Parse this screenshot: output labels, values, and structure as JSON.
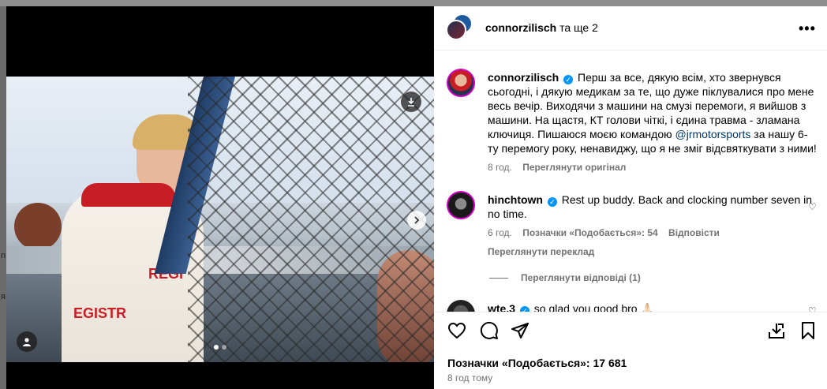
{
  "background": {
    "side_chars": [
      "n",
      "я"
    ]
  },
  "header": {
    "username": "connorzilisch",
    "others": "та ще 2",
    "more": "•••"
  },
  "post": {
    "caption_user": "connorzilisch",
    "caption_text": "Перш за все, дякую всім, хто звернувся сьогодні, і дякую медикам за те, що дуже піклувалися про мене весь вечір. Виходячи з машини на смузі перемоги, я вийшов з машини. На щастя, КТ голови чіткі, і єдина травма - зламана ключиця. Пишаюся моєю командою ",
    "caption_mention": "@jrmotorsports",
    "caption_tail": " за нашу 6-ту перемогу року, ненавиджу, що я не зміг відсвяткувати з ними!",
    "caption_time": "8 год.",
    "caption_translate": "Переглянути оригінал"
  },
  "comments": [
    {
      "user": "hinchtown",
      "text": "Rest up buddy. Back and clocking number seven in no time.",
      "time": "6 год.",
      "likes": "Позначки «Подобається»: 54",
      "reply": "Відповісти",
      "translate": "Переглянути переклад",
      "view_replies": "Переглянути відповіді (1)"
    },
    {
      "user": "wte.3",
      "text": "so glad you good bro 🙏🏻"
    }
  ],
  "photo_text": {
    "suit_regis": "REGI",
    "suit_regis2": "EGISTR"
  },
  "footer": {
    "likes": "Позначки «Подобається»: 17 681",
    "time": "8 год тому"
  },
  "colors": {
    "verified": "#0095f6",
    "mention": "#00376b",
    "meta": "#737373"
  }
}
